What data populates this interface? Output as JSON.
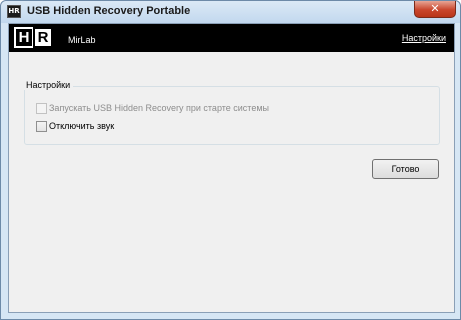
{
  "window": {
    "title": "USB Hidden Recovery Portable",
    "icon_text": "HR",
    "close_glyph": "✕"
  },
  "header": {
    "logo_h": "H",
    "logo_r": "R",
    "company": "MirLab",
    "settings_link": "Настройки"
  },
  "settings": {
    "group_label": "Настройки",
    "options": [
      {
        "label": "Запускать USB Hidden Recovery при старте системы",
        "checked": false,
        "enabled": false
      },
      {
        "label": "Отключить звук",
        "checked": false,
        "enabled": true
      }
    ]
  },
  "buttons": {
    "done_label": "Готово"
  },
  "colors": {
    "header_bg": "#000000",
    "client_bg": "#f0f0f0",
    "close_button": "#c9462c"
  }
}
